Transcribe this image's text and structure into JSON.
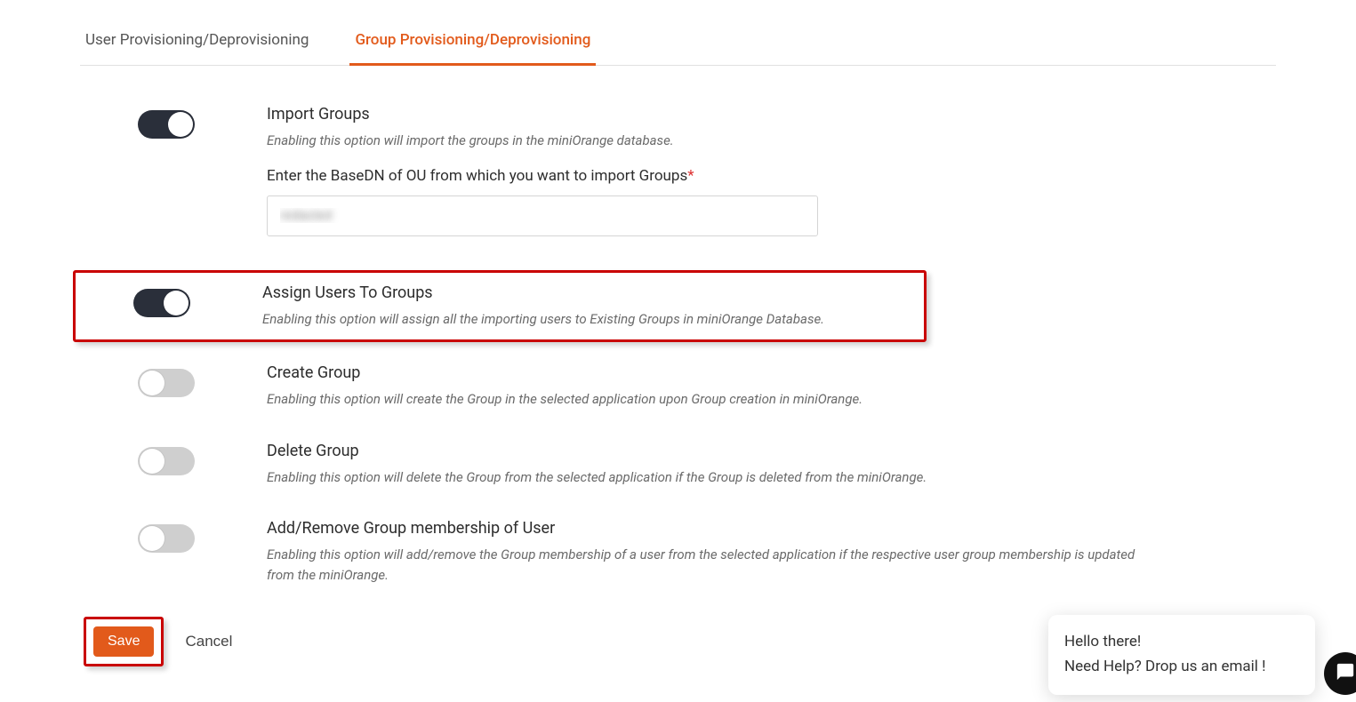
{
  "tabs": {
    "user": "User Provisioning/Deprovisioning",
    "group": "Group Provisioning/Deprovisioning",
    "active": "group"
  },
  "settings": {
    "import_groups": {
      "title": "Import Groups",
      "desc": "Enabling this option will import the groups in the miniOrange database.",
      "on": true
    },
    "basedn": {
      "label": "Enter the BaseDN of OU from which you want to import Groups",
      "value": "redacted"
    },
    "assign_users": {
      "title": "Assign Users To Groups",
      "desc": "Enabling this option will assign all the importing users to Existing Groups in miniOrange Database.",
      "on": true
    },
    "create_group": {
      "title": "Create Group",
      "desc": "Enabling this option will create the Group in the selected application upon Group creation in miniOrange.",
      "on": false
    },
    "delete_group": {
      "title": "Delete Group",
      "desc": "Enabling this option will delete the Group from the selected application if the Group is deleted from the miniOrange.",
      "on": false
    },
    "membership": {
      "title": "Add/Remove Group membership of User",
      "desc": "Enabling this option will add/remove the Group membership of a user from the selected application if the respective user group membership is updated from the miniOrange.",
      "on": false
    }
  },
  "buttons": {
    "save": "Save",
    "cancel": "Cancel"
  },
  "chat": {
    "line1": "Hello there!",
    "line2": "Need Help? Drop us an email !"
  }
}
